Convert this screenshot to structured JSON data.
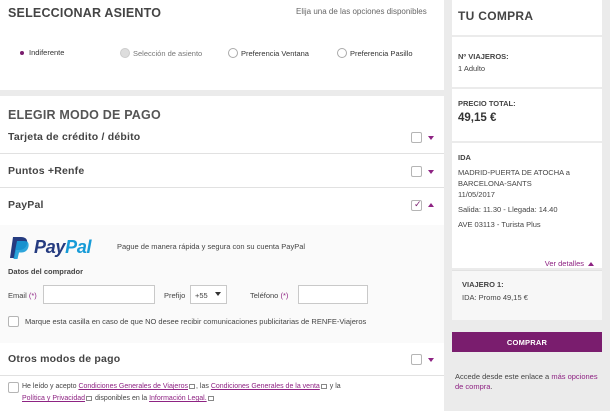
{
  "seat": {
    "title": "SELECCIONAR ASIENTO",
    "hint": "Elija una de las opciones disponibles",
    "options": [
      {
        "label": "Indiferente",
        "state": "selected"
      },
      {
        "label": "Selección de asiento",
        "state": "disabled"
      },
      {
        "label": "Preferencia Ventana",
        "state": "normal"
      },
      {
        "label": "Preferencia Pasillo",
        "state": "normal"
      }
    ]
  },
  "payment": {
    "title": "ELEGIR MODO DE PAGO",
    "methods": [
      {
        "label": "Tarjeta de crédito / débito",
        "checked": false
      },
      {
        "label": "Puntos +Renfe",
        "checked": false
      },
      {
        "label": "PayPal",
        "checked": true,
        "expanded": true
      },
      {
        "label": "Otros modos de pago",
        "checked": false
      }
    ],
    "paypal": {
      "logo_pay": "Pay",
      "logo_pal": "Pal",
      "description": "Pague de manera rápida y segura con su cuenta PayPal",
      "buyer_title": "Datos del comprador",
      "email_label": "Email",
      "required_mark": "(*)",
      "prefix_label": "Prefijo",
      "prefix_value": "+55",
      "phone_label": "Teléfono",
      "marketing_text": "Marque esta casilla en caso de que NO desee recibir comunicaciones publicitarias de RENFE-Viajeros"
    },
    "terms": {
      "t1": "He leído y acepto",
      "link1": "Condiciones Generales de Viajeros",
      "t2": ", las",
      "link2": "Condiciones Generales de la venta",
      "t3": "y la",
      "link3": "Política y Privacidad",
      "t4": "disponibles en la",
      "link4": "Información Legal."
    }
  },
  "summary": {
    "title": "TU COMPRA",
    "travelers_label": "Nº VIAJEROS:",
    "travelers_value": "1 Adulto",
    "total_label": "PRECIO TOTAL:",
    "total_value": "49,15 €",
    "trip_label": "IDA",
    "route_line1": "MADRID-PUERTA DE ATOCHA a",
    "route_line2": "BARCELONA-SANTS",
    "date": "11/05/2017",
    "times": "Salida: 11.30 - Llegada: 14.40",
    "train": "AVE 03113 - Turista Plus",
    "details_link": "Ver detalles",
    "traveler_title": "VIAJERO 1:",
    "traveler_fare": "IDA: Promo 49,15 €"
  },
  "buy_button": "COMPRAR",
  "access": {
    "text": "Accede desde este enlace a",
    "link": "más opciones de compra",
    "end": "."
  },
  "colors": {
    "accent": "#7a1d6e",
    "link": "#8e2383",
    "paypal_dark": "#253b80",
    "paypal_light": "#179bd7"
  }
}
